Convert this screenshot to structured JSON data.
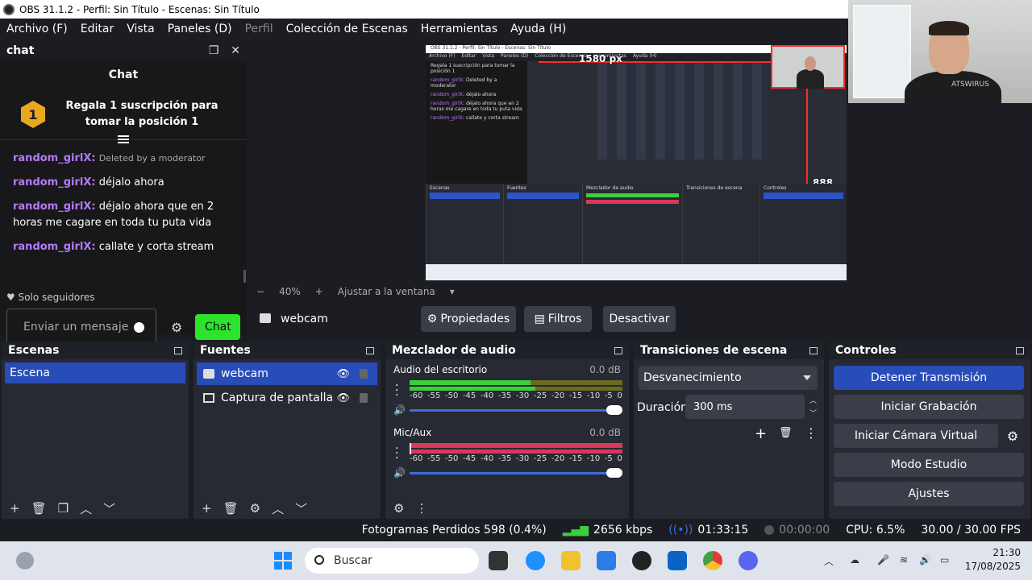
{
  "window": {
    "title": "OBS 31.1.2 - Perfil: Sin Título - Escenas: Sin Título"
  },
  "menu": [
    "Archivo (F)",
    "Editar",
    "Vista",
    "Paneles (D)",
    "Perfil",
    "Colección de Escenas",
    "Herramientas",
    "Ayuda (H)"
  ],
  "chat_dock": {
    "title": "chat",
    "panel_title": "Chat",
    "gift_badge": "1",
    "gift_text": "Regala 1 suscripción para tomar la posición 1",
    "messages": [
      {
        "user": "random_girlX",
        "text": "Deleted by a moderator",
        "deleted": true
      },
      {
        "user": "random_girlX",
        "text": "déjalo ahora"
      },
      {
        "user": "random_girlX",
        "text": "déjalo ahora que en 2 horas me cagare en toda tu puta vida"
      },
      {
        "user": "random_girlX",
        "text": "callate y corta stream"
      }
    ],
    "followers_only": "Solo seguidores",
    "input_placeholder": "Enviar un mensaje",
    "send_label": "Chat"
  },
  "preview": {
    "label_width": "1580 px",
    "label_height": "888 px",
    "mini_title": "OBS 31.1.2 - Perfil: Sin Título - Escenas: Sin Título",
    "mini_menu": [
      "Archivo (F)",
      "Editar",
      "Vista",
      "Paneles (D)",
      "Colección de Escenas",
      "Herramientas",
      "Ayuda (H)"
    ]
  },
  "zoom": {
    "value": "40%",
    "fit": "Ajustar a la ventana",
    "minus": "−",
    "plus": "+"
  },
  "source_toolbar": {
    "source": "webcam",
    "properties": "Propiedades",
    "filters": "Filtros",
    "deactivate": "Desactivar"
  },
  "scenes": {
    "title": "Escenas",
    "items": [
      "Escena"
    ]
  },
  "sources": {
    "title": "Fuentes",
    "items": [
      {
        "name": "webcam"
      },
      {
        "name": "Captura de pantalla"
      }
    ]
  },
  "mixer": {
    "title": "Mezclador de audio",
    "tracks": [
      {
        "name": "Audio del escritorio",
        "db": "0.0 dB",
        "color": "#3ccf3c"
      },
      {
        "name": "Mic/Aux",
        "db": "0.0 dB",
        "color": "#d8385a"
      }
    ],
    "ticks": [
      "-60",
      "-55",
      "-50",
      "-45",
      "-40",
      "-35",
      "-30",
      "-25",
      "-20",
      "-15",
      "-10",
      "-5",
      "0"
    ]
  },
  "transitions": {
    "title": "Transiciones de escena",
    "selected": "Desvanecimiento",
    "duration_label": "Duración",
    "duration_value": "300 ms"
  },
  "controls": {
    "title": "Controles",
    "stop_stream": "Detener Transmisión",
    "start_recording": "Iniciar Grabación",
    "start_virtual_cam": "Iniciar Cámara Virtual",
    "studio_mode": "Modo Estudio",
    "settings": "Ajustes"
  },
  "status": {
    "dropped": "Fotogramas Perdidos 598 (0.4%)",
    "bitrate": "2656 kbps",
    "stream_time": "01:33:15",
    "record_time": "00:00:00",
    "cpu": "CPU: 6.5%",
    "fps": "30.00 / 30.00 FPS"
  },
  "taskbar": {
    "search": "Buscar",
    "time": "21:30",
    "date": "17/08/2025"
  },
  "webcam_overlay": {
    "shirt_text": "ATSWIRUS"
  },
  "colors": {
    "accent": "#284cb8",
    "green": "#2ce42c",
    "red": "#ff2a2a",
    "chat_user": "#b57af5"
  }
}
